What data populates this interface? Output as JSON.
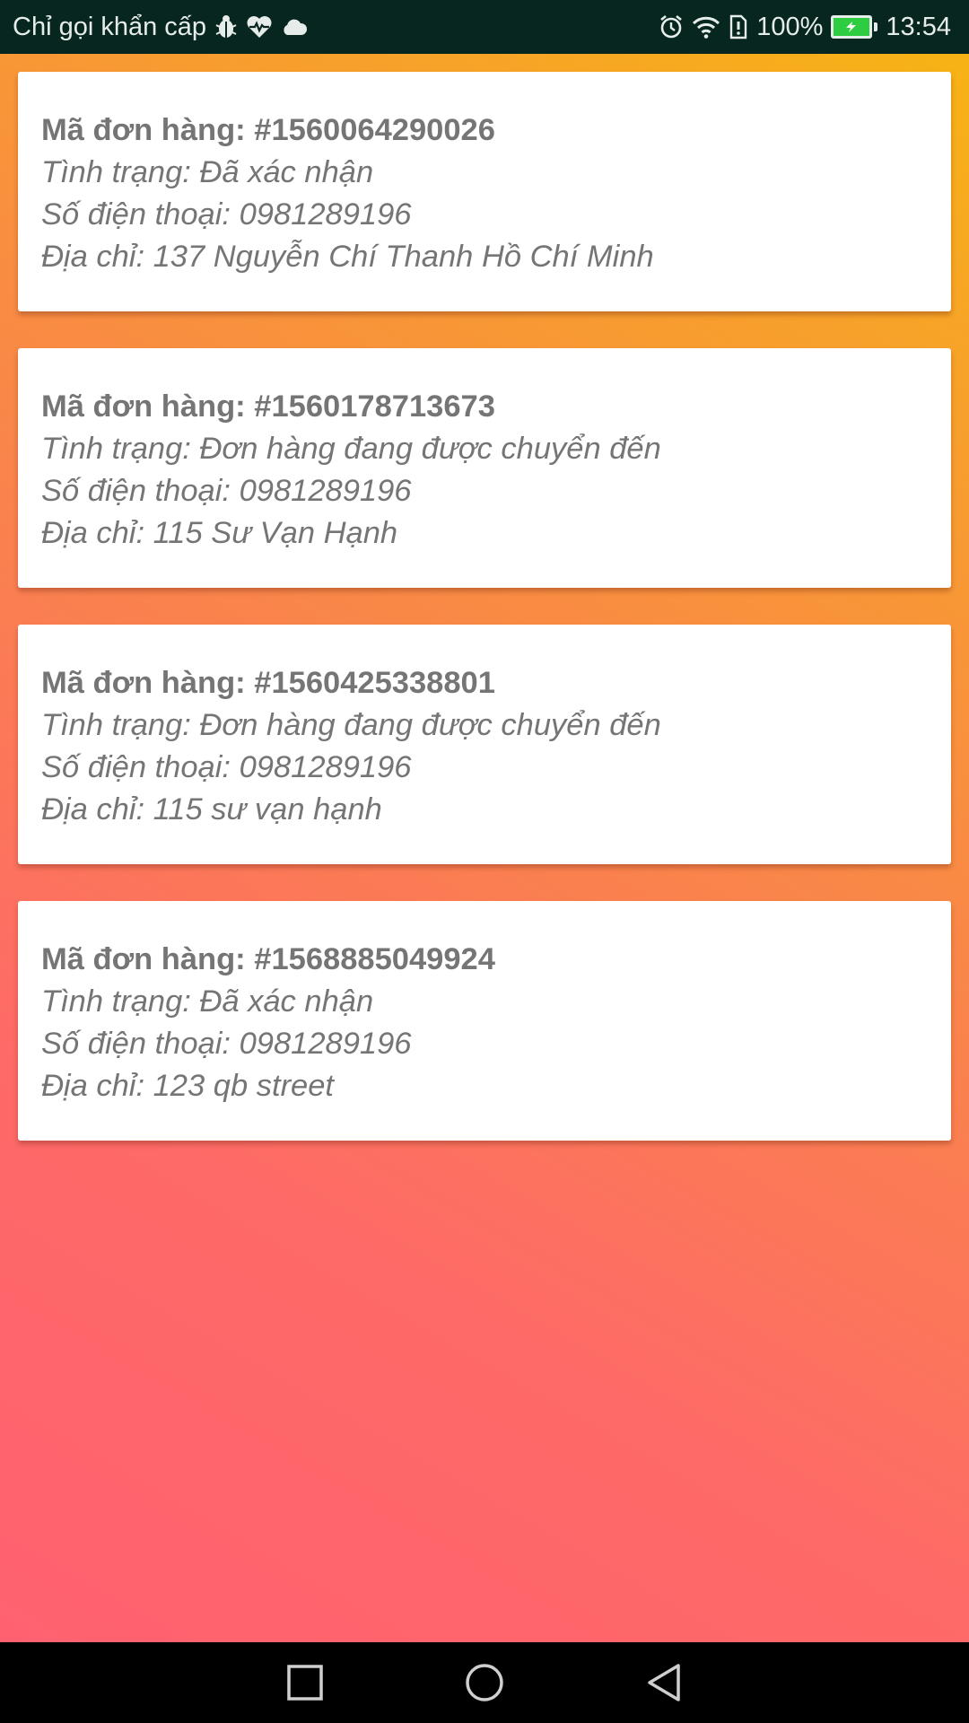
{
  "status_bar": {
    "carrier": "Chỉ gọi khẩn cấp",
    "battery": "100%",
    "time": "13:54"
  },
  "orders": [
    {
      "id": "Mã đơn hàng: #1560064290026",
      "status": "Tình trạng: Đã xác nhận",
      "phone": "Số điện thoại: 0981289196",
      "address": "Địa chỉ: 137 Nguyễn Chí Thanh Hồ Chí Minh"
    },
    {
      "id": "Mã đơn hàng: #1560178713673",
      "status": "Tình trạng: Đơn hàng đang được chuyển đến",
      "phone": "Số điện thoại: 0981289196",
      "address": "Địa chỉ: 115 Sư Vạn Hạnh"
    },
    {
      "id": "Mã đơn hàng: #1560425338801",
      "status": "Tình trạng: Đơn hàng đang được chuyển đến",
      "phone": "Số điện thoại: 0981289196",
      "address": "Địa chỉ: 115 sư vạn hạnh"
    },
    {
      "id": "Mã đơn hàng: #1568885049924",
      "status": "Tình trạng: Đã xác nhận",
      "phone": "Số điện thoại: 0981289196",
      "address": "Địa chỉ: 123 qb street"
    }
  ],
  "icons": {
    "status_left": [
      "bug-icon",
      "heart-pulse-icon",
      "cloud-icon"
    ],
    "status_right": [
      "alarm-icon",
      "wifi-icon",
      "sim-alert-icon",
      "battery-charging-icon"
    ],
    "nav": [
      "recent-apps-icon",
      "home-icon",
      "back-icon"
    ]
  },
  "colors": {
    "status_bar": "#06261f",
    "card_text": "#757575",
    "gradient": [
      "#ff6170",
      "#f98748",
      "#f7b315"
    ],
    "battery_fill": "#2ecc40"
  }
}
